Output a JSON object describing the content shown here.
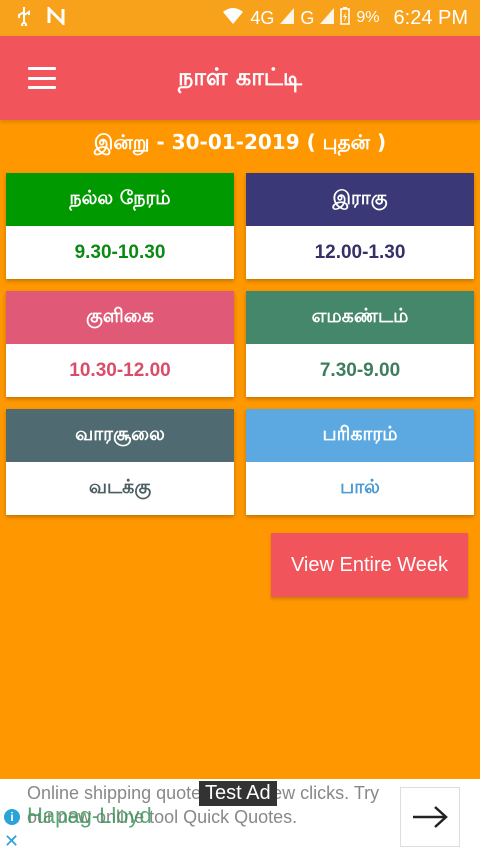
{
  "status_bar": {
    "network_type": "4G",
    "network_type2": "G",
    "battery": "9%",
    "time": "6:24 PM"
  },
  "app": {
    "title": "நாள் காட்டி"
  },
  "date_line": "இன்று - 30-01-2019 ( புதன் )",
  "cards": [
    {
      "title": "நல்ல நேரம்",
      "value": "9.30-10.30",
      "head_color": "#009A00",
      "value_color": "#0B8A13"
    },
    {
      "title": "இராகு",
      "value": "12.00-1.30",
      "head_color": "#3A3877",
      "value_color": "#34306A"
    },
    {
      "title": "குளிகை",
      "value": "10.30-12.00",
      "head_color": "#E05A78",
      "value_color": "#DA4C69"
    },
    {
      "title": "எமகண்டம்",
      "value": "7.30-9.00",
      "head_color": "#45876A",
      "value_color": "#3F7D5F"
    },
    {
      "title": "வாரசூலை",
      "value": "வடக்கு",
      "head_color": "#4F6A70",
      "value_color": "#4C5E61"
    },
    {
      "title": "பரிகாரம்",
      "value": "பால்",
      "head_color": "#5BA9E0",
      "value_color": "#4A9AD3"
    }
  ],
  "view_week_button": "View Entire Week",
  "ad": {
    "label": "Test Ad",
    "brand": "Hapag-Lloyd",
    "text": "Online shipping quotes with a few clicks. Try our new online tool Quick Quotes."
  },
  "colors": {
    "background": "#FF9800",
    "app_bar": "#F2545B",
    "status_bar": "#F7A21A"
  }
}
